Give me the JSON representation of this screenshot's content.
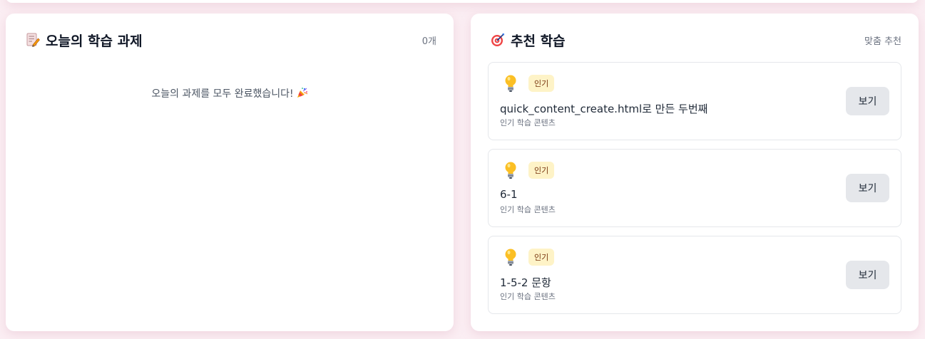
{
  "today": {
    "title": "오늘의 학습 과제",
    "count": "0개",
    "empty_message": "오늘의 과제를 모두 완료했습니다!",
    "icon": "memo-icon",
    "empty_icon": "party-popper-icon"
  },
  "recommend": {
    "title": "추천 학습",
    "meta": "맞춤 추천",
    "icon": "target-icon",
    "items": [
      {
        "badge": "인기",
        "title": "quick_content_create.html로 만든 두번째",
        "subtitle": "인기 학습 콘텐츠",
        "button": "보기",
        "icon": "lightbulb-icon"
      },
      {
        "badge": "인기",
        "title": "6-1",
        "subtitle": "인기 학습 콘텐츠",
        "button": "보기",
        "icon": "lightbulb-icon"
      },
      {
        "badge": "인기",
        "title": "1-5-2 문항",
        "subtitle": "인기 학습 콘텐츠",
        "button": "보기",
        "icon": "lightbulb-icon"
      }
    ]
  }
}
